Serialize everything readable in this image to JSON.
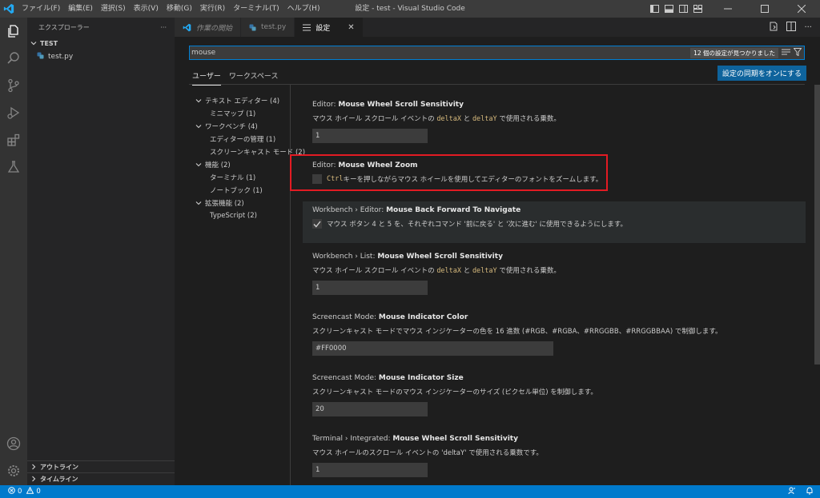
{
  "titlebar": {
    "title": "設定 - test - Visual Studio Code",
    "menu": [
      "ファイル(F)",
      "編集(E)",
      "選択(S)",
      "表示(V)",
      "移動(G)",
      "実行(R)",
      "ターミナル(T)",
      "ヘルプ(H)"
    ]
  },
  "sidebar": {
    "header": "エクスプローラー",
    "more": "···",
    "folder": "TEST",
    "file": "test.py",
    "outline": "アウトライン",
    "timeline": "タイムライン"
  },
  "tabs": [
    {
      "label": "作業の開始",
      "active": false
    },
    {
      "label": "test.py",
      "active": false
    },
    {
      "label": "設定",
      "active": true
    }
  ],
  "settings": {
    "search_value": "mouse",
    "search_count": "12 個の設定が見つかりました",
    "scope_user": "ユーザー",
    "scope_workspace": "ワークスペース",
    "sync_button": "設定の同期をオンにする",
    "toc": [
      {
        "label": "テキスト エディター (4)",
        "level": 1
      },
      {
        "label": "ミニマップ (1)",
        "level": 2
      },
      {
        "label": "ワークベンチ (4)",
        "level": 1
      },
      {
        "label": "エディターの管理 (1)",
        "level": 2
      },
      {
        "label": "スクリーンキャスト モード (2)",
        "level": 2
      },
      {
        "label": "機能 (2)",
        "level": 1
      },
      {
        "label": "ターミナル (1)",
        "level": 2
      },
      {
        "label": "ノートブック (1)",
        "level": 2
      },
      {
        "label": "拡張機能 (2)",
        "level": 1
      },
      {
        "label": "TypeScript (2)",
        "level": 2
      }
    ],
    "items": [
      {
        "category": "Editor: ",
        "name": "Mouse Wheel Scroll Sensitivity",
        "desc_a": "マウス ホイール スクロール イベントの ",
        "code1": "deltaX",
        "desc_b": " と ",
        "code2": "deltaY",
        "desc_c": " で使用される乗数。",
        "value": "1"
      },
      {
        "category": "Editor: ",
        "name": "Mouse Wheel Zoom",
        "code": "Ctrl",
        "desc": " キーを押しながらマウス ホイールを使用してエディターのフォントをズームします。",
        "checked": false
      },
      {
        "category": "Workbench › Editor: ",
        "name": "Mouse Back Forward To Navigate",
        "desc": "マウス ボタン 4 と 5 を、それぞれコマンド '前に戻る' と '次に進む' に使用できるようにします。",
        "checked": true
      },
      {
        "category": "Workbench › List: ",
        "name": "Mouse Wheel Scroll Sensitivity",
        "desc_a": "マウス ホイール スクロール イベントの ",
        "code1": "deltaX",
        "desc_b": " と ",
        "code2": "deltaY",
        "desc_c": " で使用される乗数。",
        "value": "1"
      },
      {
        "category": "Screencast Mode: ",
        "name": "Mouse Indicator Color",
        "desc": "スクリーンキャスト モードでマウス インジケーターの色を 16 進数 (#RGB、#RGBA、#RRGGBB、#RRGGBBAA) で制御します。",
        "value": "#FF0000"
      },
      {
        "category": "Screencast Mode: ",
        "name": "Mouse Indicator Size",
        "desc": "スクリーンキャスト モードのマウス インジケーターのサイズ (ピクセル単位) を制御します。",
        "value": "20"
      },
      {
        "category": "Terminal › Integrated: ",
        "name": "Mouse Wheel Scroll Sensitivity",
        "desc": "マウス ホイールのスクロール イベントの 'deltaY' で使用される乗数です。",
        "value": "1"
      }
    ]
  },
  "statusbar": {
    "errors": "0",
    "warnings": "0"
  },
  "colors": {
    "accent": "#007acc",
    "highlight_box": "#e31b23",
    "code": "#d7ba7d"
  }
}
